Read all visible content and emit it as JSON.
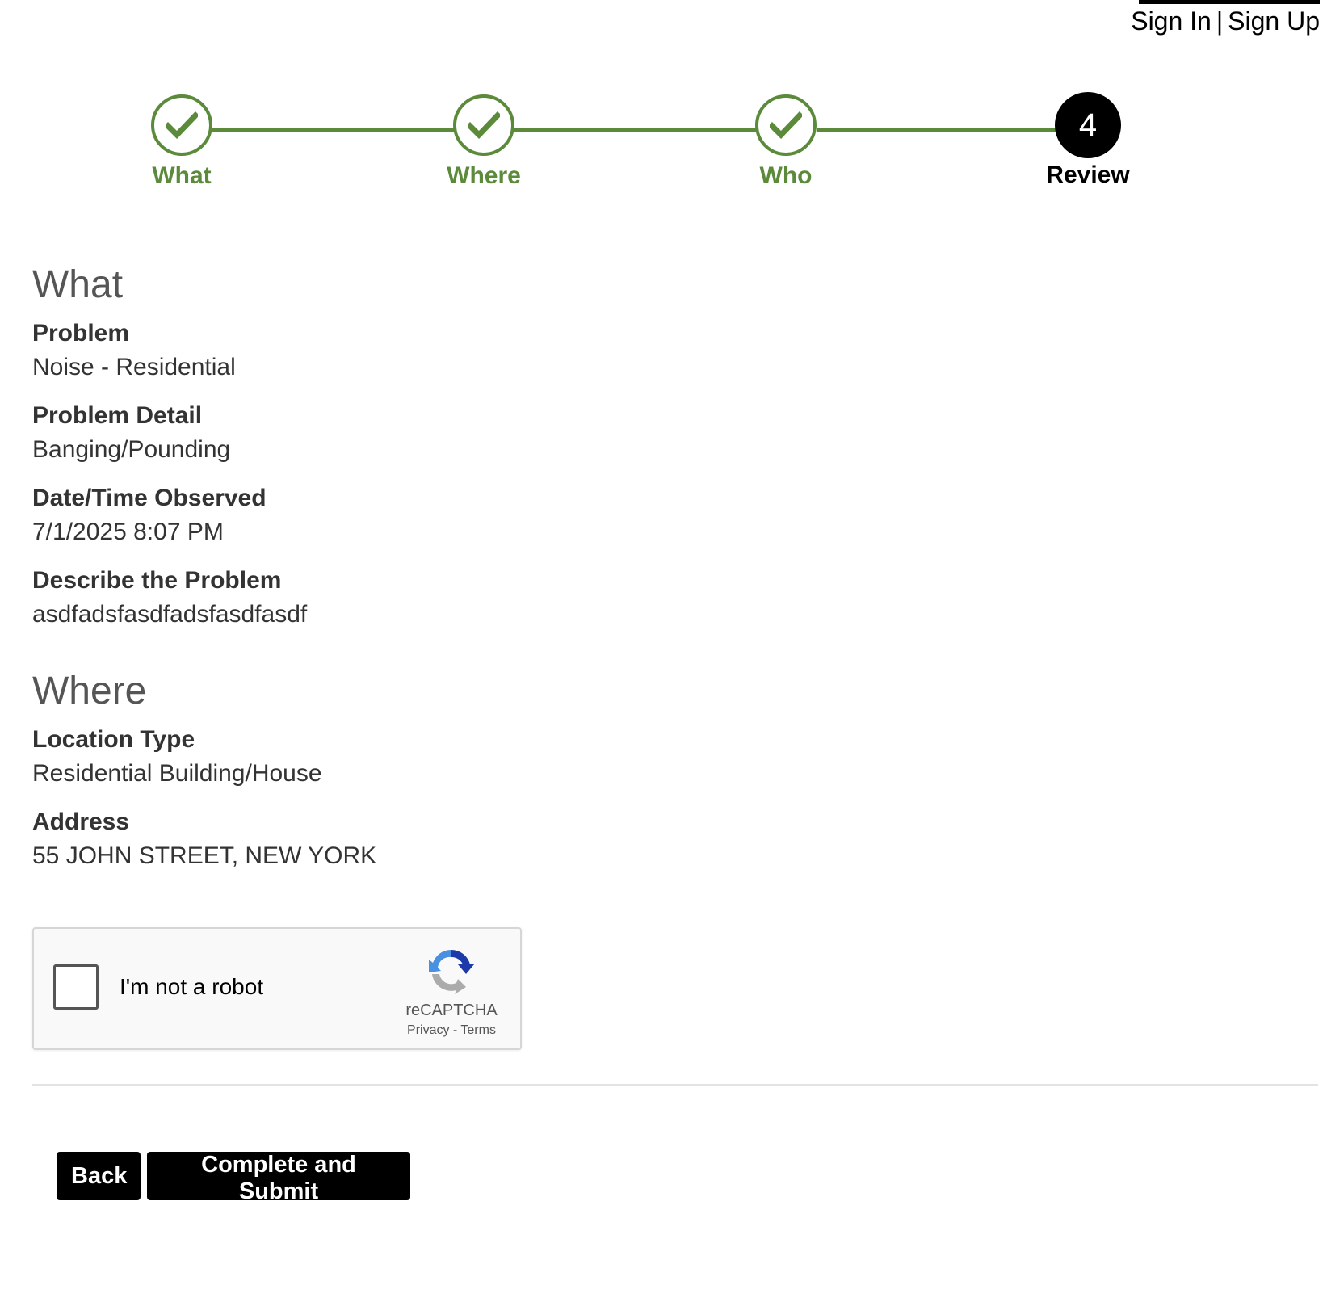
{
  "auth": {
    "sign_in": "Sign In",
    "separator": "|",
    "sign_up": "Sign Up"
  },
  "stepper": {
    "steps": [
      {
        "label": "What",
        "status": "complete",
        "icon": "check-icon"
      },
      {
        "label": "Where",
        "status": "complete",
        "icon": "check-icon"
      },
      {
        "label": "Who",
        "status": "complete",
        "icon": "check-icon"
      },
      {
        "label": "Review",
        "status": "current",
        "number": "4"
      }
    ],
    "complete_color": "#5a8a3a",
    "current_color": "#000000"
  },
  "review": {
    "what": {
      "title": "What",
      "fields": [
        {
          "label": "Problem",
          "value": "Noise - Residential"
        },
        {
          "label": "Problem Detail",
          "value": "Banging/Pounding"
        },
        {
          "label": "Date/Time Observed",
          "value": "7/1/2025 8:07 PM"
        },
        {
          "label": "Describe the Problem",
          "value": "asdfadsfasdfadsfasdfasdf"
        }
      ]
    },
    "where": {
      "title": "Where",
      "fields": [
        {
          "label": "Location Type",
          "value": "Residential Building/House"
        },
        {
          "label": "Address",
          "value": "55 JOHN STREET, NEW YORK"
        }
      ]
    }
  },
  "captcha": {
    "checkbox_label": "I'm not a robot",
    "brand": "reCAPTCHA",
    "privacy": "Privacy",
    "links_separator": "-",
    "terms": "Terms",
    "checked": false
  },
  "actions": {
    "back": "Back",
    "submit": "Complete and Submit"
  }
}
